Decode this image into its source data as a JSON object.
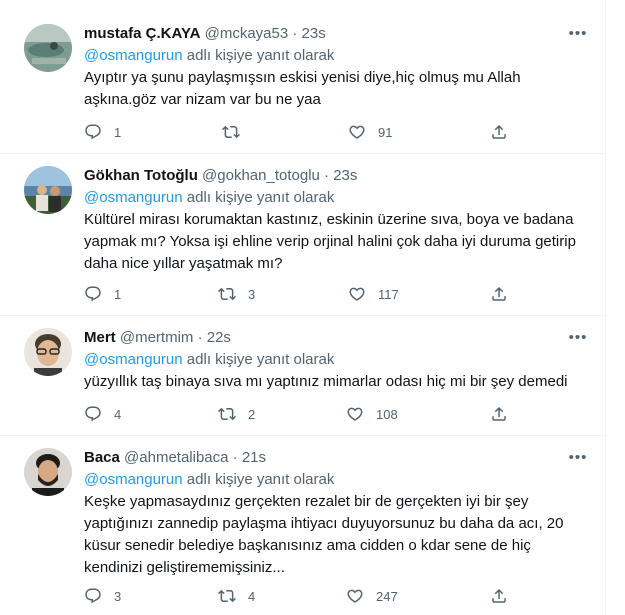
{
  "reply_prefix": "adlı kişiye yanıt olarak",
  "more_glyph": "•••",
  "tweets": [
    {
      "name": "mustafa Ç.KAYA",
      "handle": "@mckaya53",
      "dot": "·",
      "time": "23s",
      "reply_mention": "@osmangurun",
      "text": "Ayıptır ya şunu paylaşmışsın eskisi yenisi diye,hiç olmuş mu Allah aşkına.göz var nizam var bu ne yaa",
      "replies": "1",
      "retweets": "",
      "likes": "91",
      "avatar": "avatar-beach"
    },
    {
      "name": "Gökhan Totoğlu",
      "handle": "@gokhan_totoglu",
      "dot": "·",
      "time": "23s",
      "reply_mention": "@osmangurun",
      "text": "Kültürel  mirası korumaktan kastınız, eskinin üzerine sıva, boya ve badana yapmak mı? Yoksa işi ehline verip orjinal halini çok daha iyi duruma getirip daha nice yıllar yaşatmak mı?",
      "replies": "1",
      "retweets": "3",
      "likes": "117",
      "avatar": "avatar-couple"
    },
    {
      "name": "Mert",
      "handle": "@mertmim",
      "dot": "·",
      "time": "22s",
      "reply_mention": "@osmangurun",
      "text": "yüzyıllık taş binaya sıva mı yaptınız mimarlar odası hiç mi bir şey demedi",
      "replies": "4",
      "retweets": "2",
      "likes": "108",
      "avatar": "avatar-man"
    },
    {
      "name": "Baca",
      "handle": "@ahmetalibaca",
      "dot": "·",
      "time": "21s",
      "reply_mention": "@osmangurun",
      "text": "Keşke yapmasaydınız gerçekten rezalet bir de gerçekten iyi bir şey yaptığınızı zannedip paylaşma ihtiyacı duyuyorsunuz bu daha da acı, 20 küsur senedir belediye başkanısınız ama cidden o kdar sene de hiç kendinizi geliştirememişsiniz...",
      "replies": "3",
      "retweets": "4",
      "likes": "247",
      "avatar": "avatar-bearded"
    }
  ]
}
